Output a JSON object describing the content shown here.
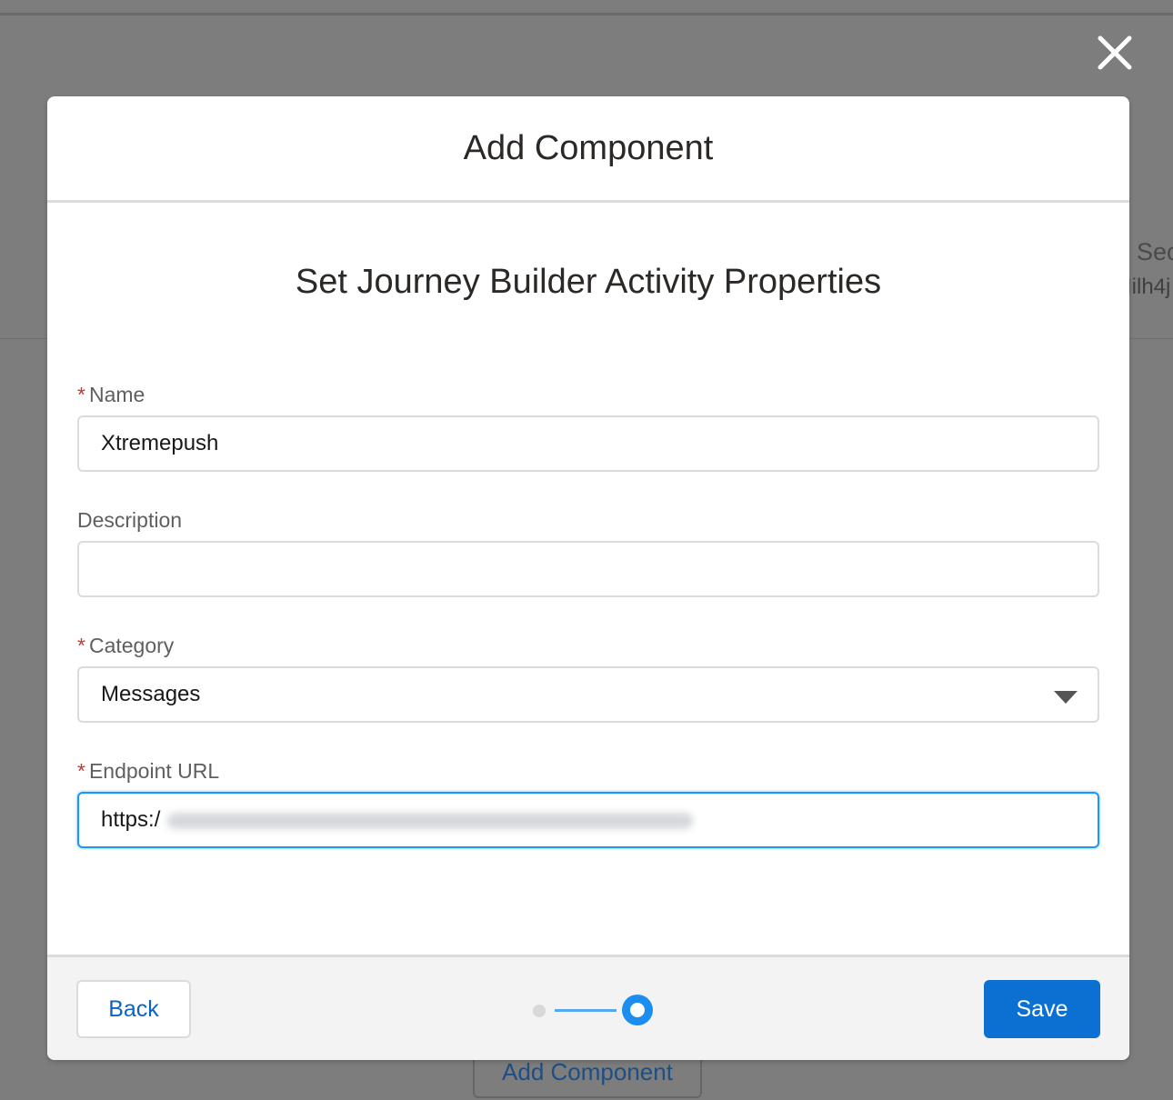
{
  "background": {
    "partial_text_1": "Sec",
    "partial_text_2": "Iilh4j",
    "add_component_label": "Add Component"
  },
  "modal": {
    "title": "Add Component",
    "section_title": "Set Journey Builder Activity Properties",
    "fields": {
      "name": {
        "label": "Name",
        "required": true,
        "value": "Xtremepush"
      },
      "description": {
        "label": "Description",
        "required": false,
        "value": ""
      },
      "category": {
        "label": "Category",
        "required": true,
        "value": "Messages"
      },
      "endpoint_url": {
        "label": "Endpoint URL",
        "required": true,
        "value": "https:/"
      }
    },
    "footer": {
      "back_label": "Back",
      "save_label": "Save",
      "step_current": 2,
      "step_total": 2
    }
  },
  "icons": {
    "close": "close-icon",
    "select_arrow": "chevron-down-icon"
  },
  "colors": {
    "accent": "#0b70d2",
    "required": "#c23934",
    "focus": "#1b96ff"
  }
}
